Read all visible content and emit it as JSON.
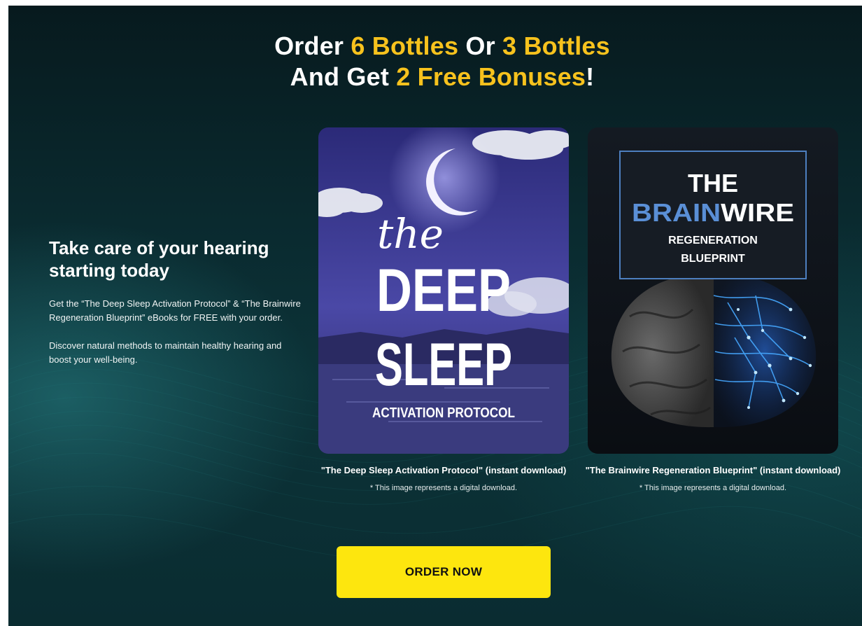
{
  "headline": {
    "line1_prefix": "Order ",
    "line1_highlight_a": "6 Bottles",
    "line1_middle": " Or ",
    "line1_highlight_b": "3 Bottles",
    "line2_prefix": "And Get ",
    "line2_highlight": "2 Free Bonuses",
    "line2_suffix": "!"
  },
  "intro": {
    "title": "Take care of your hearing starting today",
    "paragraph1": "Get the “The Deep Sleep Activation Protocol” & “The Brainwire Regeneration Blueprint” eBooks for FREE with your order.",
    "paragraph2": "Discover natural methods to maintain healthy hearing and boost your well-being."
  },
  "bonuses": [
    {
      "cover": {
        "word_the": "the",
        "word_deep": "DEEP",
        "word_sleep": "SLEEP",
        "subtitle": "ACTIVATION PROTOCOL"
      },
      "title": "\"The Deep Sleep Activation Protocol\" (instant download)",
      "note": "* This image represents a digital download."
    },
    {
      "cover": {
        "word_the": "THE",
        "word_brain": "BRAIN",
        "word_wire": "WIRE",
        "line_regeneration": "REGENERATION",
        "line_blueprint": "BLUEPRINT"
      },
      "title": "\"The Brainwire Regeneration Blueprint\" (instant download)",
      "note": "* This image represents a digital download."
    }
  ],
  "cta": {
    "label": "ORDER NOW"
  },
  "colors": {
    "accent_yellow": "#f7c21d",
    "button_yellow": "#fde60e",
    "background_teal": "#0c3338"
  }
}
